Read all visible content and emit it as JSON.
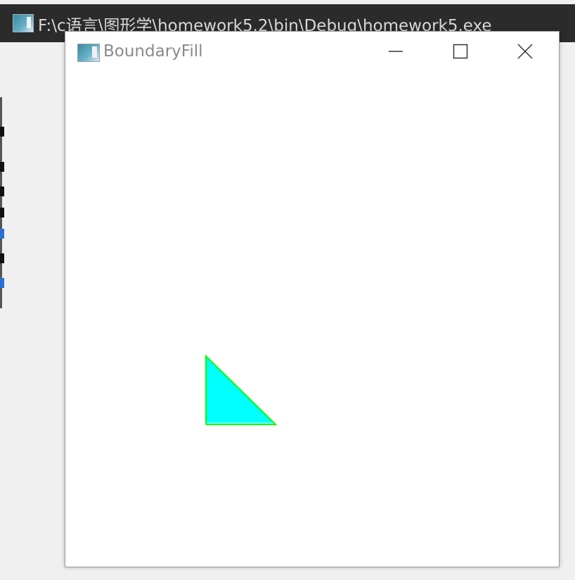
{
  "background_window": {
    "title": "F:\\c语言\\图形学\\homework5.2\\bin\\Debug\\homework5.exe",
    "icon": "app-window-icon"
  },
  "app_window": {
    "title": "BoundaryFill",
    "icon": "app-window-icon",
    "controls": {
      "minimize": "minimize-icon",
      "maximize": "maximize-icon",
      "close": "close-icon"
    }
  },
  "drawing": {
    "shape": "right-triangle",
    "fill_color": "#00ffff",
    "boundary_color": "#00ff00"
  }
}
